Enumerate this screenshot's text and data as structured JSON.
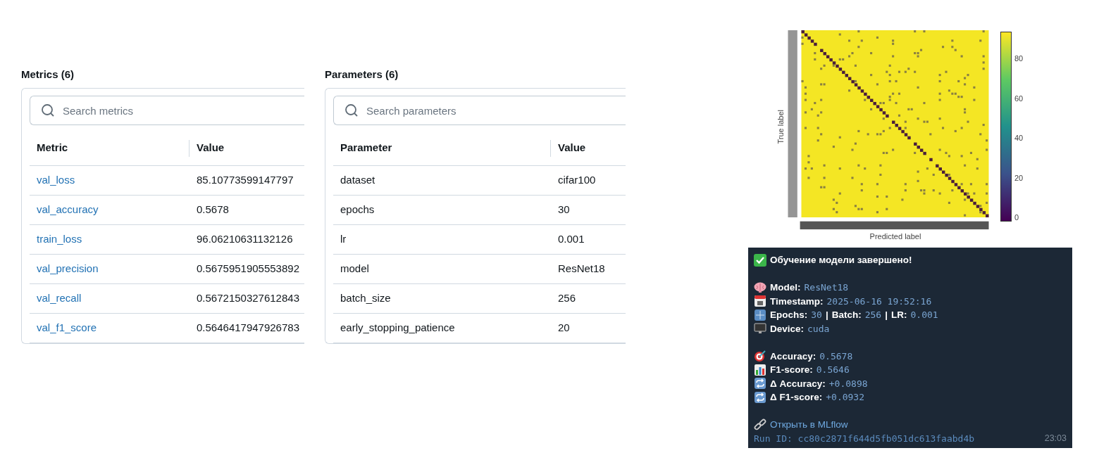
{
  "metrics": {
    "title": "Metrics (6)",
    "search": {
      "placeholder": "Search metrics"
    },
    "columns": [
      "Metric",
      "Value"
    ],
    "link_names": true,
    "rows": [
      {
        "name": "val_loss",
        "value": "85.10773599147797"
      },
      {
        "name": "val_accuracy",
        "value": "0.5678"
      },
      {
        "name": "train_loss",
        "value": "96.06210631132126"
      },
      {
        "name": "val_precision",
        "value": "0.5675951905553892"
      },
      {
        "name": "val_recall",
        "value": "0.5672150327612843"
      },
      {
        "name": "val_f1_score",
        "value": "0.5646417947926783"
      }
    ]
  },
  "parameters": {
    "title": "Parameters (6)",
    "search": {
      "placeholder": "Search parameters"
    },
    "columns": [
      "Parameter",
      "Value"
    ],
    "link_names": false,
    "rows": [
      {
        "name": "dataset",
        "value": "cifar100"
      },
      {
        "name": "epochs",
        "value": "30"
      },
      {
        "name": "lr",
        "value": "0.001"
      },
      {
        "name": "model",
        "value": "ResNet18"
      },
      {
        "name": "batch_size",
        "value": "256"
      },
      {
        "name": "early_stopping_patience",
        "value": "20"
      }
    ]
  },
  "confusion_matrix": {
    "xlabel": "Predicted label",
    "ylabel": "True label",
    "colorbar_ticks": [
      "80",
      "60",
      "40",
      "20",
      "0"
    ]
  },
  "message": {
    "title": "Обучение модели завершено!",
    "groups": [
      [
        {
          "parts": [
            {
              "kind": "label",
              "text": "Model:"
            },
            {
              "kind": "code",
              "text": "ResNet18"
            }
          ]
        },
        {
          "parts": [
            {
              "kind": "label",
              "text": "Timestamp:"
            },
            {
              "kind": "code",
              "text": "2025-06-16 19:52:16"
            }
          ]
        },
        {
          "parts": [
            {
              "kind": "label",
              "text": "Epochs:"
            },
            {
              "kind": "code",
              "text": "30"
            },
            {
              "kind": "sep",
              "text": "|"
            },
            {
              "kind": "label",
              "text": "Batch:"
            },
            {
              "kind": "code",
              "text": "256"
            },
            {
              "kind": "sep",
              "text": "|"
            },
            {
              "kind": "label",
              "text": "LR:"
            },
            {
              "kind": "code",
              "text": "0.001"
            }
          ]
        },
        {
          "parts": [
            {
              "kind": "label",
              "text": "Device:"
            },
            {
              "kind": "code",
              "text": "cuda"
            }
          ]
        }
      ],
      [
        {
          "parts": [
            {
              "kind": "label",
              "text": "Accuracy:"
            },
            {
              "kind": "code",
              "text": "0.5678"
            }
          ]
        },
        {
          "parts": [
            {
              "kind": "label",
              "text": "F1-score:"
            },
            {
              "kind": "code",
              "text": "0.5646"
            }
          ]
        },
        {
          "parts": [
            {
              "kind": "label",
              "text": "Δ Accuracy:"
            },
            {
              "kind": "code",
              "text": "+0.0898"
            }
          ]
        },
        {
          "parts": [
            {
              "kind": "label",
              "text": "Δ F1-score:"
            },
            {
              "kind": "code",
              "text": "+0.0932"
            }
          ]
        }
      ]
    ],
    "link": "Открыть в MLflow",
    "run_id": "Run ID: cc80c2871f644d5fb051dc613faabd4b",
    "time": "23:03"
  }
}
